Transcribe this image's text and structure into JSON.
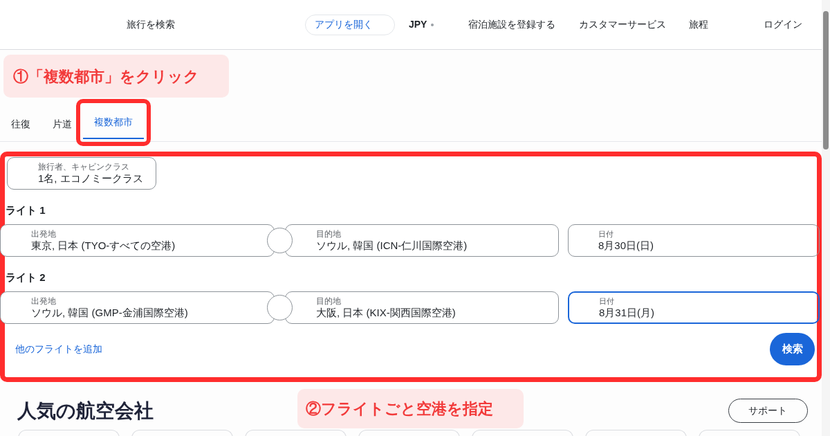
{
  "header": {
    "nav": [
      {
        "kind": "link",
        "label": "旅行を検索"
      },
      {
        "kind": "pill",
        "label": "アプリを開く"
      },
      {
        "kind": "currency",
        "label": "JPY"
      },
      {
        "kind": "link",
        "label": "宿泊施設を登録する"
      },
      {
        "kind": "link",
        "label": "カスタマーサービス"
      },
      {
        "kind": "link",
        "label": "旅程"
      },
      {
        "kind": "link",
        "label": "ログイン"
      }
    ]
  },
  "annotations": [
    "①「複数都市」をクリック",
    "②フライトごと空港を指定"
  ],
  "tabs": [
    {
      "label": "往復",
      "selected": false
    },
    {
      "label": "片道",
      "selected": false
    },
    {
      "label": "複数都市",
      "selected": true
    }
  ],
  "travelers": {
    "label": "旅行者、キャビンクラス",
    "value": "1名, エコノミークラス"
  },
  "flights": [
    {
      "title": "ライト 1",
      "origin": {
        "label": "出発地",
        "value": "東京, 日本 (TYO-すべての空港)"
      },
      "destination": {
        "label": "目的地",
        "value": "ソウル, 韓国 (ICN-仁川国際空港)"
      },
      "date": {
        "label": "日付",
        "value": "8月30日(日)",
        "focused": false
      }
    },
    {
      "title": "ライト 2",
      "origin": {
        "label": "出発地",
        "value": "ソウル, 韓国 (GMP-金浦国際空港)"
      },
      "destination": {
        "label": "目的地",
        "value": "大阪, 日本 (KIX-関西国際空港)"
      },
      "date": {
        "label": "日付",
        "value": "8月31日(月)",
        "focused": true
      }
    }
  ],
  "add_flight": "他のフライトを追加",
  "search_button": "検索",
  "section": {
    "title": "人気の航空会社",
    "support_button": "サポート"
  }
}
